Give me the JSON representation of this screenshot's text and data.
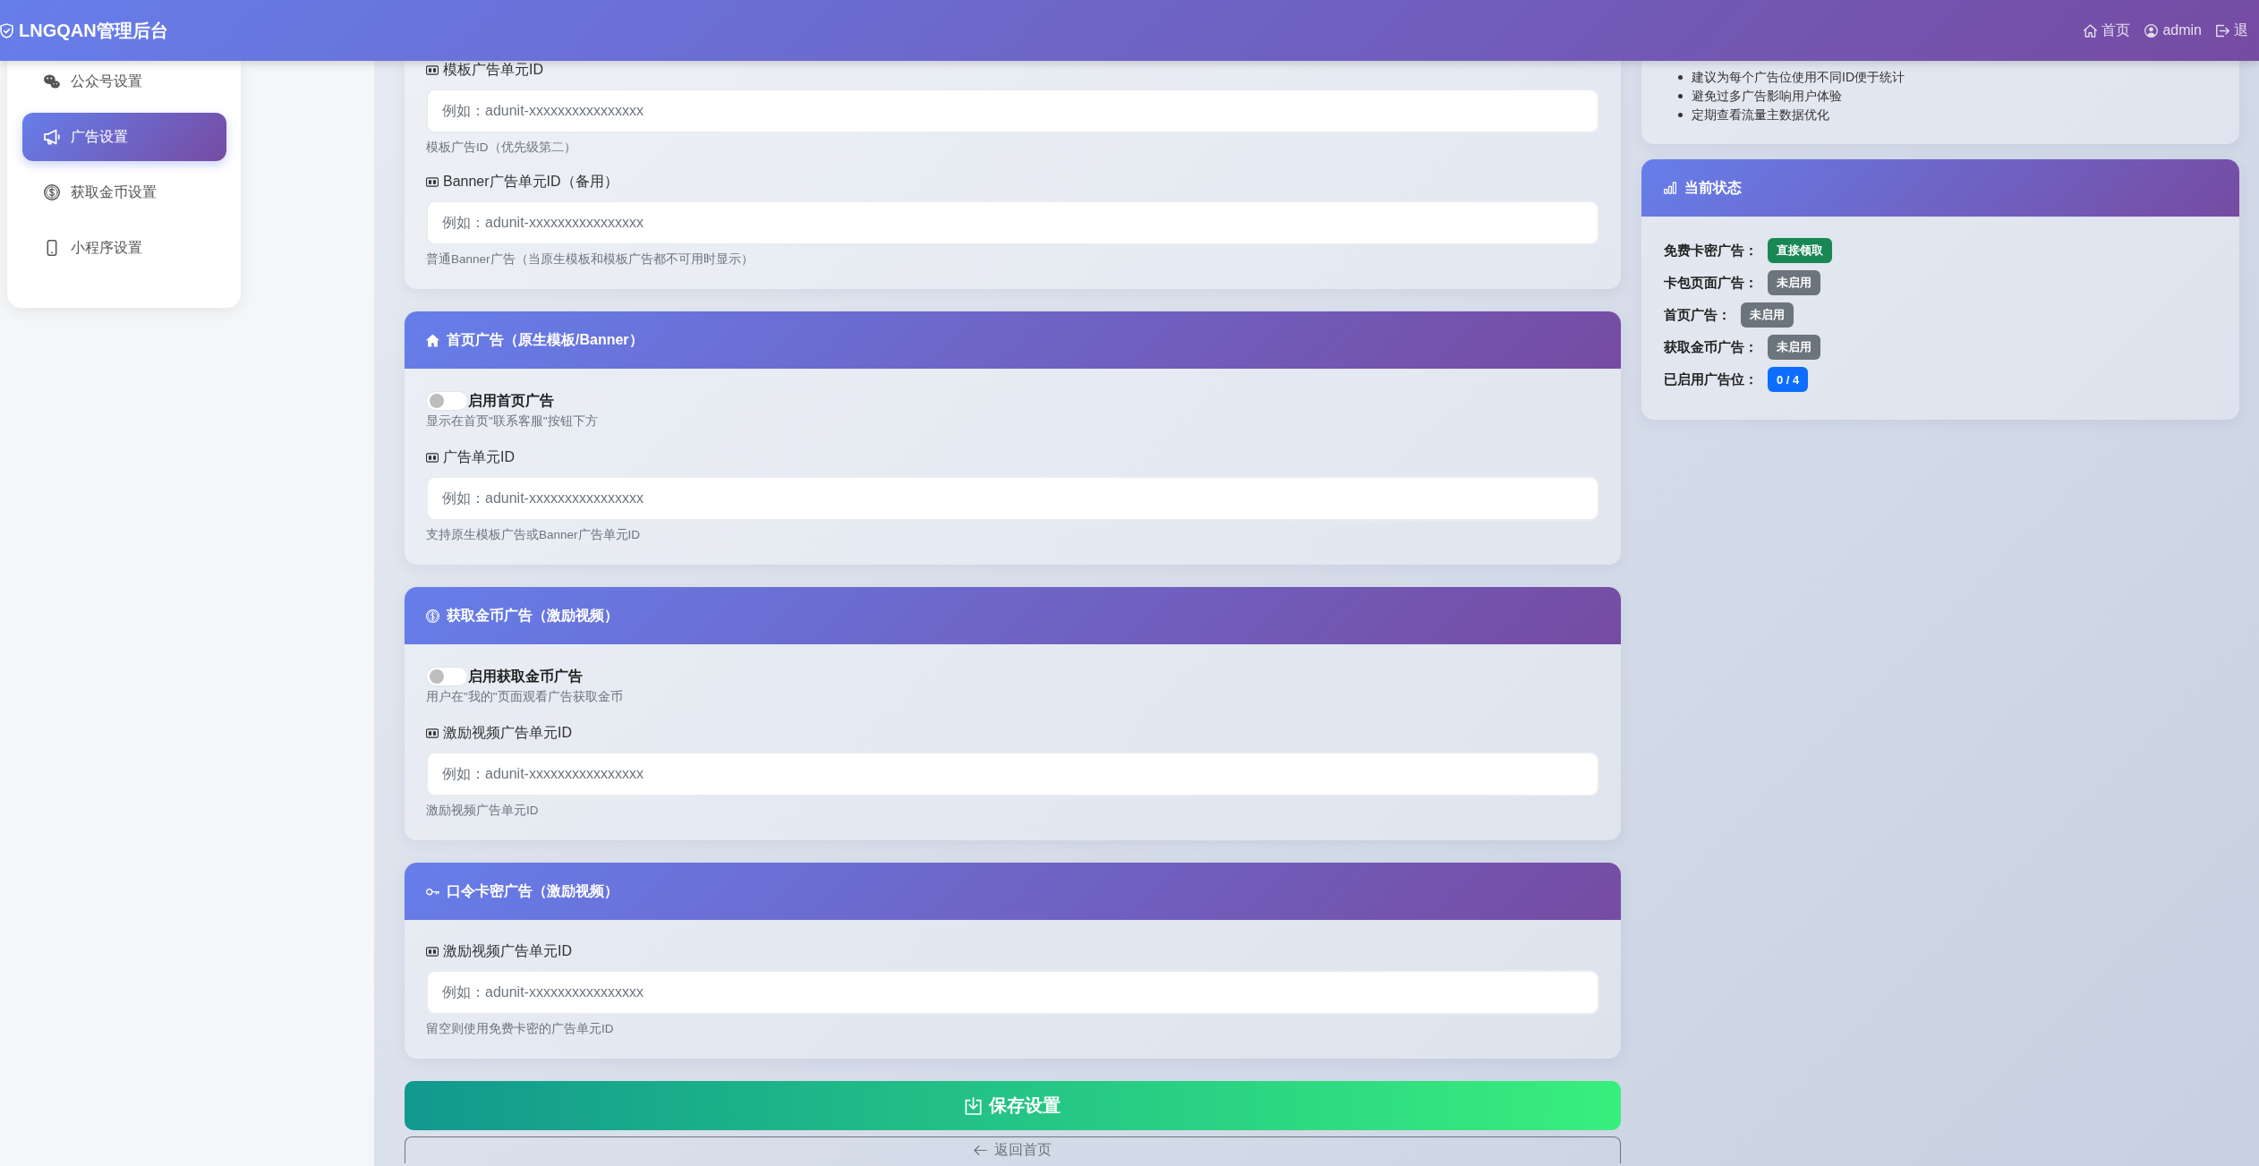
{
  "header": {
    "brand": "LNGQAN管理后台",
    "nav": [
      {
        "kind": "home",
        "label": "首页"
      },
      {
        "kind": "user",
        "label": "admin"
      },
      {
        "kind": "logout",
        "label": "退"
      }
    ]
  },
  "sidebar": {
    "items": [
      {
        "kind": "wechat",
        "label": "公众号设置",
        "selected": false
      },
      {
        "kind": "ads",
        "label": "广告设置",
        "selected": true
      },
      {
        "kind": "coins",
        "label": "获取金币设置",
        "selected": false
      },
      {
        "kind": "miniprogram",
        "label": "小程序设置",
        "selected": false
      }
    ]
  },
  "main": {
    "cards": [
      {
        "fields": [
          {
            "label": "模板广告单元ID",
            "placeholder": "例如：adunit-xxxxxxxxxxxxxxxx",
            "help": "模板广告ID（优先级第二）"
          },
          {
            "label": "Banner广告单元ID（备用）",
            "placeholder": "例如：adunit-xxxxxxxxxxxxxxxx",
            "help": "普通Banner广告（当原生模板和模板广告都不可用时显示）"
          }
        ]
      },
      {
        "kind": "home",
        "title": "首页广告（原生模板/Banner）",
        "toggle": {
          "label": "启用首页广告",
          "on": false,
          "help": "显示在首页\"联系客服\"按钮下方"
        },
        "fields": [
          {
            "label": "广告单元ID",
            "placeholder": "例如：adunit-xxxxxxxxxxxxxxxx",
            "help": "支持原生模板广告或Banner广告单元ID"
          }
        ]
      },
      {
        "kind": "coins",
        "title": "获取金币广告（激励视频）",
        "toggle": {
          "label": "启用获取金币广告",
          "on": false,
          "help": "用户在\"我的\"页面观看广告获取金币"
        },
        "fields": [
          {
            "label": "激励视频广告单元ID",
            "placeholder": "例如：adunit-xxxxxxxxxxxxxxxx",
            "help": "激励视频广告单元ID"
          }
        ]
      },
      {
        "kind": "passcode",
        "title": "口令卡密广告（激励视频）",
        "fields": [
          {
            "label": "激励视频广告单元ID",
            "placeholder": "例如：adunit-xxxxxxxxxxxxxxxx",
            "help": "留空则使用免费卡密的广告单元ID"
          }
        ]
      }
    ],
    "save_button": {
      "label": "保存设置"
    },
    "back_button": {
      "label": "返回首页"
    }
  },
  "tips": {
    "items": [
      "建议为每个广告位使用不同ID便于统计",
      "避免过多广告影响用户体验",
      "定期查看流量主数据优化"
    ]
  },
  "status": {
    "title": "当前状态",
    "rows": [
      {
        "label": "免费卡密广告：",
        "badge": "直接领取",
        "color": "#198754"
      },
      {
        "label": "卡包页面广告：",
        "badge": "未启用",
        "color": "#6c757d"
      },
      {
        "label": "首页广告：",
        "badge": "未启用",
        "color": "#6c757d"
      },
      {
        "label": "获取金币广告：",
        "badge": "未启用",
        "color": "#6c757d"
      },
      {
        "label": "已启用广告位：",
        "badge": "0 / 4",
        "color": "#0d6efd"
      }
    ]
  }
}
